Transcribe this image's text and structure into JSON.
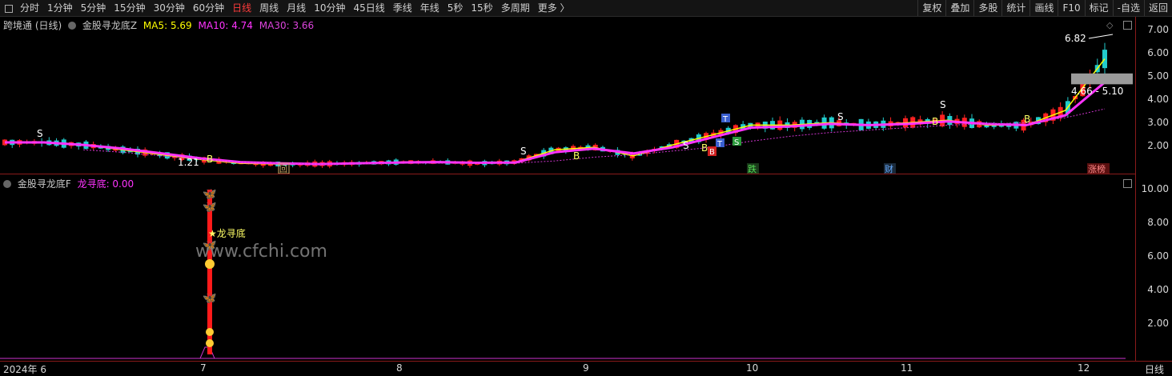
{
  "toolbar": {
    "periods": [
      "分时",
      "1分钟",
      "5分钟",
      "15分钟",
      "30分钟",
      "60分钟",
      "日线",
      "周线",
      "月线",
      "10分钟",
      "45日线",
      "季线",
      "年线",
      "5秒",
      "15秒",
      "多周期",
      "更多 〉"
    ],
    "active": "日线",
    "right_buttons": [
      "复权",
      "叠加",
      "多股",
      "统计",
      "画线",
      "F10",
      "标记",
      "-自选",
      "返回"
    ]
  },
  "top_panel": {
    "stock": "跨境通 (日线)",
    "indicator": "金股寻龙底Z",
    "ma5": "MA5: 5.69",
    "ma10": "MA10: 4.74",
    "ma30": "MA30: 3.66",
    "colors": {
      "ma5": "#ffff00",
      "ma10": "#ff33ff",
      "ma30": "#cc33cc",
      "up": "#ff2222",
      "down": "#22cccc"
    },
    "yticks": [
      "7.00",
      "6.00",
      "5.00",
      "4.00",
      "3.00",
      "2.00"
    ],
    "high_label": "6.82",
    "low_label": "1.21",
    "range_label": "4.66 - 5.10",
    "markers": {
      "s": "S",
      "b": "B",
      "t": "T",
      "die": "跌",
      "cai": "财",
      "zhang": "涨榜",
      "hui": "回"
    }
  },
  "bottom_panel": {
    "indicator": "金股寻龙底F",
    "value": "龙寻底: 0.00",
    "signal_label": "★龙寻底",
    "yticks": [
      "10.00",
      "8.00",
      "6.00",
      "4.00",
      "2.00"
    ]
  },
  "watermark": "www.cfchi.com",
  "xaxis": {
    "labels": [
      "2024年 6",
      "7",
      "8",
      "9",
      "10",
      "11",
      "12"
    ],
    "right_label": "日线"
  },
  "chart_data": {
    "type": "line",
    "series": [
      {
        "name": "MA5",
        "values": [
          2.3,
          2.3,
          2.2,
          2.0,
          1.8,
          1.6,
          1.45,
          1.42,
          1.42,
          1.45,
          1.5,
          1.5,
          1.45,
          1.5,
          2.0,
          2.1,
          1.75,
          2.2,
          2.6,
          3.0,
          3.0,
          3.1,
          3.0,
          3.1,
          3.2,
          3.0,
          3.0,
          3.6,
          5.69
        ]
      },
      {
        "name": "MA10",
        "values": [
          2.3,
          2.3,
          2.2,
          2.05,
          1.85,
          1.65,
          1.5,
          1.45,
          1.42,
          1.45,
          1.48,
          1.5,
          1.47,
          1.48,
          1.9,
          2.05,
          1.85,
          2.1,
          2.5,
          2.9,
          2.95,
          3.05,
          3.0,
          3.05,
          3.15,
          3.05,
          3.0,
          3.4,
          4.74
        ]
      },
      {
        "name": "MA30",
        "values": [
          null,
          null,
          2.0,
          1.9,
          1.75,
          1.6,
          1.5,
          1.45,
          1.42,
          1.42,
          1.45,
          1.45,
          1.45,
          1.45,
          1.55,
          1.7,
          1.8,
          1.95,
          2.1,
          2.35,
          2.55,
          2.7,
          2.8,
          2.9,
          3.0,
          3.05,
          3.1,
          3.3,
          3.66
        ]
      }
    ],
    "ylim": [
      1.0,
      7.4
    ]
  }
}
